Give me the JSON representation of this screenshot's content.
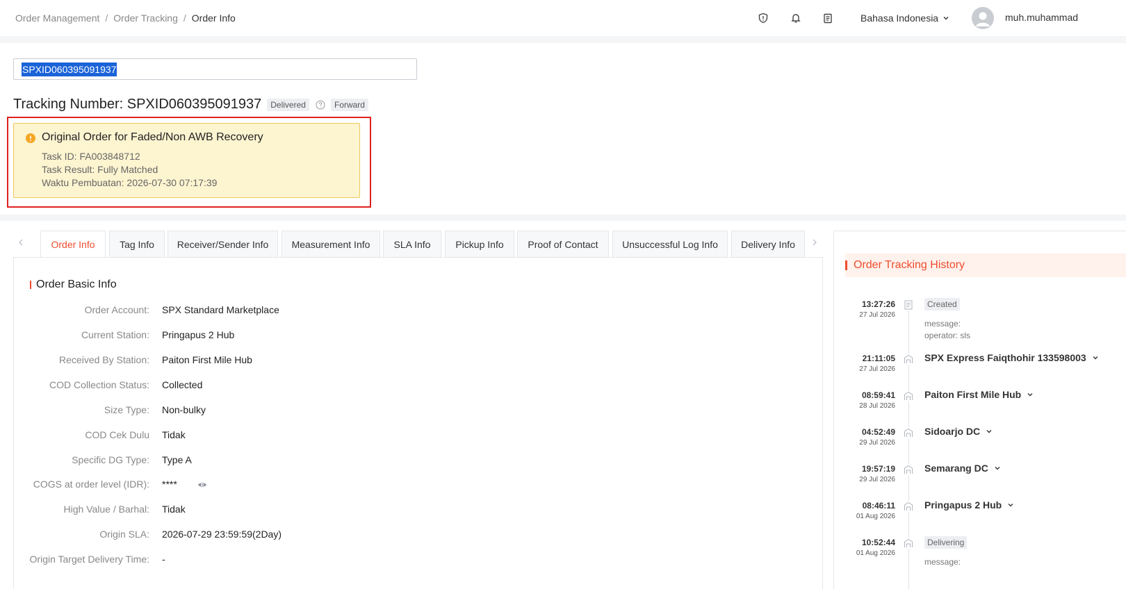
{
  "breadcrumb": {
    "item1": "Order Management",
    "item2": "Order Tracking",
    "item3": "Order Info"
  },
  "header": {
    "language": "Bahasa Indonesia",
    "username": "muh.muhammad"
  },
  "search": {
    "value": "SPXID060395091937"
  },
  "tracking": {
    "label": "Tracking Number: SPXID060395091937",
    "status": "Delivered",
    "direction": "Forward"
  },
  "alert": {
    "title": "Original Order for Faded/Non AWB Recovery",
    "task_id": "Task ID: FA003848712",
    "task_result": "Task Result: Fully Matched",
    "created": "Waktu Pembuatan: 2026-07-30 07:17:39"
  },
  "tabs": [
    "Order Info",
    "Tag Info",
    "Receiver/Sender Info",
    "Measurement Info",
    "SLA Info",
    "Pickup Info",
    "Proof of Contact",
    "Unsuccessful Log Info",
    "Delivery Info"
  ],
  "section": {
    "title": "Order Basic Info"
  },
  "fields": [
    {
      "label": "Order Account:",
      "value": "SPX Standard Marketplace"
    },
    {
      "label": "Current Station:",
      "value": "Pringapus 2 Hub"
    },
    {
      "label": "Received By Station:",
      "value": "Paiton First Mile Hub"
    },
    {
      "label": "COD Collection Status:",
      "value": "Collected"
    },
    {
      "label": "Size Type:",
      "value": "Non-bulky"
    },
    {
      "label": "COD Cek Dulu",
      "value": "Tidak"
    },
    {
      "label": "Specific DG Type:",
      "value": "Type A"
    },
    {
      "label": "COGS at order level (IDR):",
      "value": "****"
    },
    {
      "label": "High Value / Barhal:",
      "value": "Tidak"
    },
    {
      "label": "Origin SLA:",
      "value": "2026-07-29 23:59:59(2Day)"
    },
    {
      "label": "Origin Target Delivery Time:",
      "value": "-"
    }
  ],
  "history": {
    "title": "Order Tracking History",
    "items": [
      {
        "time": "13:27:26",
        "date": "27 Jul 2026",
        "badge": "Created",
        "message": "message:",
        "operator": "operator: sls"
      },
      {
        "time": "21:11:05",
        "date": "27 Jul 2026",
        "title": "SPX Express Faiqthohir 133598003"
      },
      {
        "time": "08:59:41",
        "date": "28 Jul 2026",
        "title": "Paiton First Mile Hub"
      },
      {
        "time": "04:52:49",
        "date": "29 Jul 2026",
        "title": "Sidoarjo DC"
      },
      {
        "time": "19:57:19",
        "date": "29 Jul 2026",
        "title": "Semarang DC"
      },
      {
        "time": "08:46:11",
        "date": "01 Aug 2026",
        "title": "Pringapus 2 Hub"
      },
      {
        "time": "10:52:44",
        "date": "01 Aug 2026",
        "badge": "Delivering",
        "message": "message:"
      }
    ]
  }
}
